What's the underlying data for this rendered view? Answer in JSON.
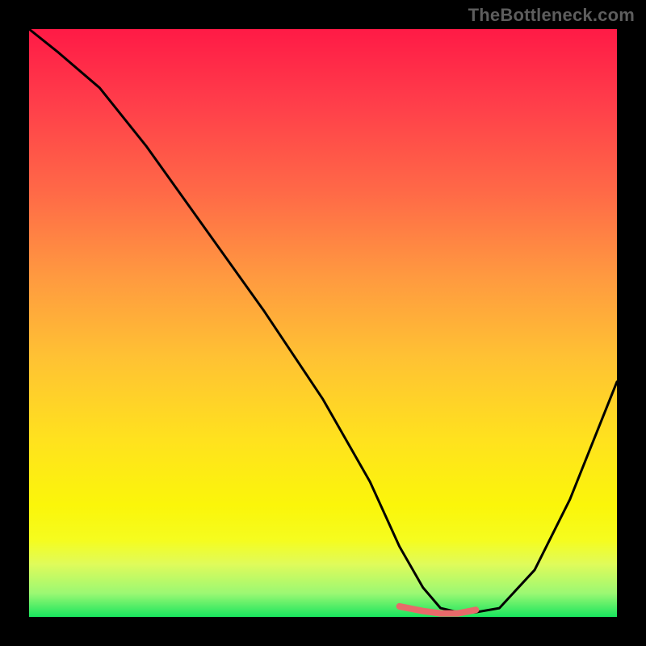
{
  "watermark": "TheBottleneck.com",
  "chart_data": {
    "type": "line",
    "title": "",
    "xlabel": "",
    "ylabel": "",
    "xlim": [
      0,
      100
    ],
    "ylim": [
      0,
      100
    ],
    "series": [
      {
        "name": "bottleneck-curve",
        "x": [
          0,
          5,
          12,
          20,
          30,
          40,
          50,
          58,
          63,
          67,
          70,
          73,
          76,
          80,
          86,
          92,
          100
        ],
        "y": [
          100,
          96,
          90,
          80,
          66,
          52,
          37,
          23,
          12,
          5,
          1.5,
          0.8,
          0.8,
          1.5,
          8,
          20,
          40
        ]
      },
      {
        "name": "highlight-segment",
        "x": [
          63,
          67,
          70,
          73,
          76
        ],
        "y": [
          1.8,
          1.0,
          0.6,
          0.6,
          1.2
        ]
      }
    ],
    "gradient_stops": [
      {
        "pos": 0,
        "color": "#ff1a46"
      },
      {
        "pos": 12,
        "color": "#ff3c4a"
      },
      {
        "pos": 28,
        "color": "#ff6a47"
      },
      {
        "pos": 42,
        "color": "#ff9940"
      },
      {
        "pos": 56,
        "color": "#ffc233"
      },
      {
        "pos": 70,
        "color": "#ffe21e"
      },
      {
        "pos": 81,
        "color": "#fbf60a"
      },
      {
        "pos": 87,
        "color": "#f5fc1f"
      },
      {
        "pos": 91,
        "color": "#e0fb5a"
      },
      {
        "pos": 96,
        "color": "#9bf873"
      },
      {
        "pos": 100,
        "color": "#18e55e"
      }
    ],
    "colors": {
      "curve": "#000000",
      "highlight": "#e86a6a",
      "frame": "#000000"
    }
  }
}
